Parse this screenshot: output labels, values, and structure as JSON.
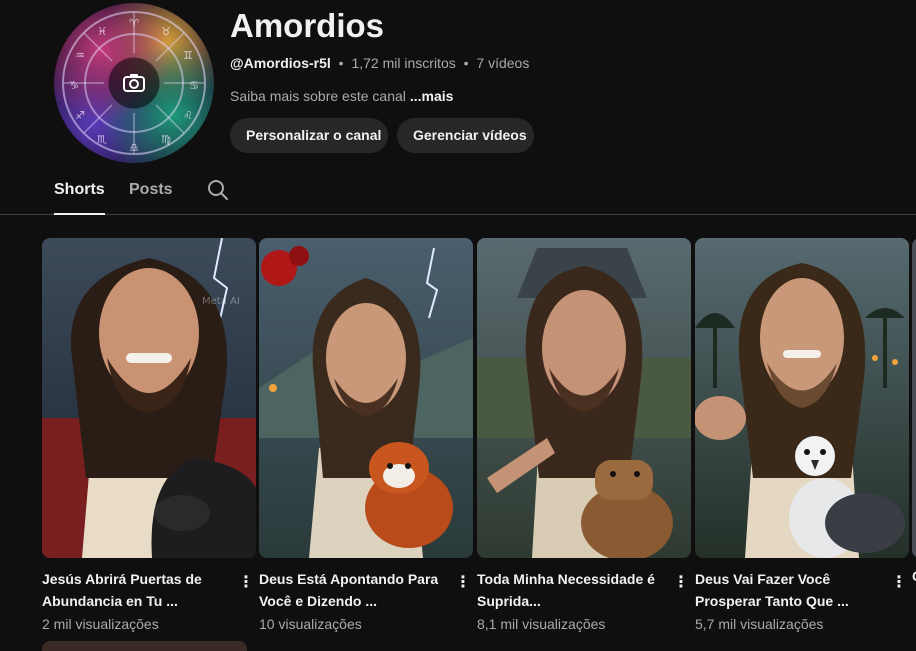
{
  "channel": {
    "name": "Amordios",
    "handle": "@Amordios-r5l",
    "separator": "•",
    "subscribers": "1,72 mil inscritos",
    "videos": "7 vídeos",
    "about_text": "Saiba mais sobre este canal",
    "about_more": "...mais",
    "avatar_icon": "camera-icon"
  },
  "actions": {
    "customize_label": "Personalizar o canal",
    "manage_label": "Gerenciar vídeos"
  },
  "tabs": [
    {
      "label": "Shorts",
      "selected": true
    },
    {
      "label": "Posts",
      "selected": false
    }
  ],
  "search_icon": "search-icon",
  "shorts": [
    {
      "title": "Jesús Abrirá Puertas de Abundancia en Tu ...",
      "views": "2 mil visualizações",
      "menu": "⋮",
      "watermark": "Meta AI",
      "animal": "tapir"
    },
    {
      "title": "Deus Está Apontando Para Você e Dizendo ...",
      "views": "10 visualizações",
      "menu": "⋮",
      "animal": "red-panda"
    },
    {
      "title": "Toda Minha Necessidade é Suprida...",
      "views": "8,1 mil visualizações",
      "menu": "⋮",
      "animal": "capybara"
    },
    {
      "title": "Deus Vai Fazer Você Prosperar Tanto Que ...",
      "views": "5,7 mil visualizações",
      "menu": "⋮",
      "animal": "harpy-eagle"
    }
  ],
  "edge_card_initial": "C"
}
